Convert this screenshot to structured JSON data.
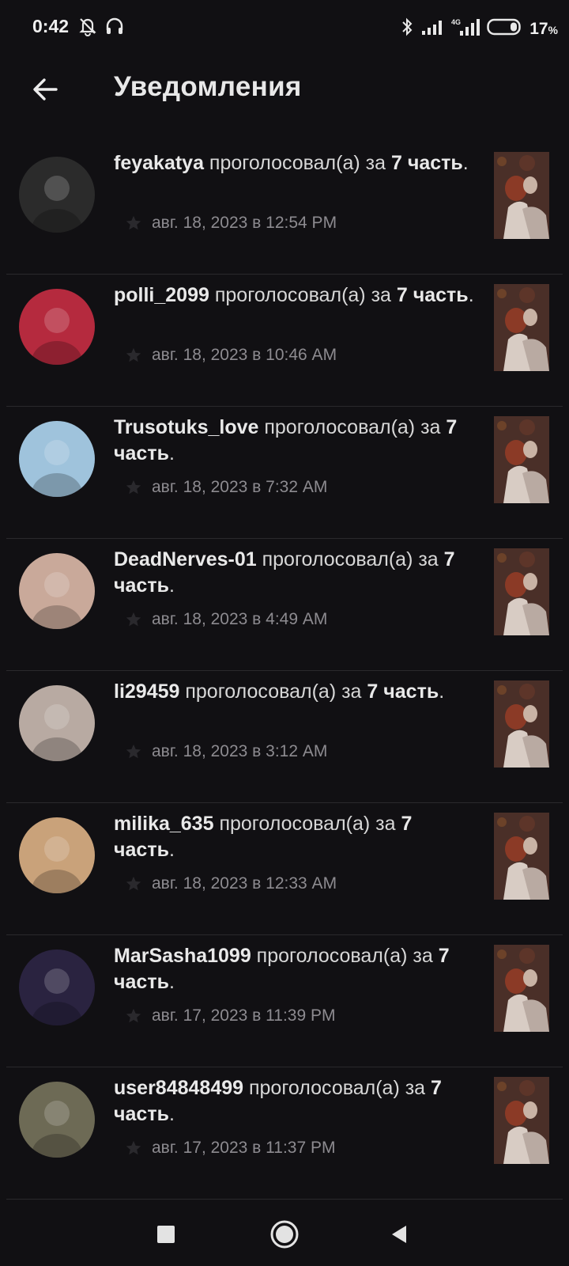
{
  "status_bar": {
    "time": "0:42",
    "battery_percent": "17",
    "battery_unit": "%"
  },
  "header": {
    "title": "Уведомления"
  },
  "notifications": [
    {
      "username": "feyakatya",
      "action": " проголосовал(а) за ",
      "part": "7 часть",
      "suffix": ".",
      "date": "авг. 18, 2023 в 12:54 PM",
      "avatar_color": "#2b2b2b"
    },
    {
      "username": "polli_2099",
      "action": " проголосовал(а) за ",
      "part": "7 часть",
      "suffix": ".",
      "date": "авг. 18, 2023 в 10:46 AM",
      "avatar_color": "#b52a3e"
    },
    {
      "username": "Trusotuks_love",
      "action": " проголосовал(а) за ",
      "part": "7 часть",
      "suffix": ".",
      "date": "авг. 18, 2023 в 7:32 AM",
      "avatar_color": "#9fc3dc"
    },
    {
      "username": "DeadNerves-01",
      "action": " проголосовал(а) за ",
      "part": "7 часть",
      "suffix": ".",
      "date": "авг. 18, 2023 в 4:49 AM",
      "avatar_color": "#c9a99a"
    },
    {
      "username": "li29459",
      "action": " проголосовал(а) за ",
      "part": "7 часть",
      "suffix": ".",
      "date": "авг. 18, 2023 в 3:12 AM",
      "avatar_color": "#b8aaa2"
    },
    {
      "username": "milika_635",
      "action": " проголосовал(а) за ",
      "part": "7 часть",
      "suffix": ".",
      "date": "авг. 18, 2023 в 12:33 AM",
      "avatar_color": "#c9a27a"
    },
    {
      "username": "MarSasha1099",
      "action": " проголосовал(а) за ",
      "part": "7 часть",
      "suffix": ".",
      "date": "авг. 17, 2023 в 11:39 PM",
      "avatar_color": "#2a2340"
    },
    {
      "username": "user84848499",
      "action": " проголосовал(а) за ",
      "part": "7 часть",
      "suffix": ".",
      "date": "авг. 17, 2023 в 11:37 PM",
      "avatar_color": "#6d6a55"
    }
  ]
}
